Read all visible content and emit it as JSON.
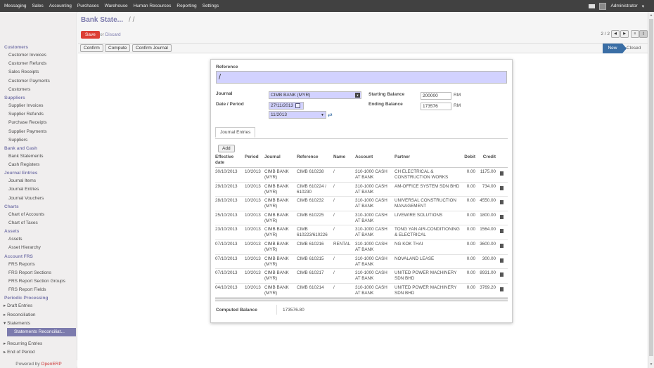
{
  "topbar": {
    "menu": [
      "Messaging",
      "Sales",
      "Accounting",
      "Purchases",
      "Warehouse",
      "Human Resources",
      "Reporting",
      "Settings"
    ],
    "user": "Administrator"
  },
  "sidebar": {
    "sections": [
      {
        "title": "Customers",
        "items": [
          "Customer Invoices",
          "Customer Refunds",
          "Sales Receipts",
          "Customer Payments",
          "Customers"
        ]
      },
      {
        "title": "Suppliers",
        "items": [
          "Supplier Invoices",
          "Supplier Refunds",
          "Purchase Receipts",
          "Supplier Payments",
          "Suppliers"
        ]
      },
      {
        "title": "Bank and Cash",
        "items": [
          "Bank Statements",
          "Cash Registers"
        ]
      },
      {
        "title": "Journal Entries",
        "items": [
          "Journal Items",
          "Journal Entries",
          "Journal Vouchers"
        ]
      },
      {
        "title": "Charts",
        "items": [
          "Chart of Accounts",
          "Chart of Taxes"
        ]
      },
      {
        "title": "Assets",
        "items": [
          "Assets",
          "Asset Hierarchy"
        ]
      },
      {
        "title": "Account FRS",
        "items": [
          "FRS Reports",
          "FRS Report Sections",
          "FRS Report Section Groups",
          "FRS Report Fields"
        ]
      }
    ],
    "periodic": {
      "title": "Periodic Processing",
      "items": [
        "Draft Entries",
        "Reconciliation",
        "Statements"
      ],
      "selected": "Statements Reconciliat...",
      "after": [
        "Recurring Entries",
        "End of Period"
      ]
    },
    "powered_prefix": "Powered by ",
    "powered_brand": "OpenERP"
  },
  "header": {
    "breadcrumb": "Bank State...",
    "breadcrumb_sep": "/ /",
    "save": "Save",
    "or": "or",
    "discard": "Discard",
    "pager": "2 / 2"
  },
  "statusbar": {
    "buttons": [
      "Confirm",
      "Compute",
      "Confirm Journal"
    ],
    "states": [
      "New",
      "Closed"
    ]
  },
  "form": {
    "reference_label": "Reference",
    "reference_value": "/",
    "journal_label": "Journal",
    "journal_value": "CIMB BANK (MYR)",
    "date_label": "Date / Period",
    "date_value": "27/11/2013",
    "period_value": "11/2013",
    "starting_label": "Starting Balance",
    "starting_value": "200000",
    "ending_label": "Ending Balance",
    "ending_value": "173576",
    "currency": "RM",
    "tab": "Journal Entries",
    "add": "Add",
    "computed_label": "Computed Balance",
    "computed_value": "173576.80"
  },
  "grid": {
    "headers": [
      "Effective date",
      "Period",
      "Journal",
      "Reference",
      "Name",
      "Account",
      "Partner",
      "Debit",
      "Credit"
    ],
    "rows": [
      [
        "30/10/2013",
        "10/2013",
        "CIMB BANK (MYR)",
        "CIMB 610238",
        "/",
        "310-1000 CASH AT BANK",
        "CH ELECTRICAL & CONSTRUCTION WORKS",
        "0.00",
        "1175.00"
      ],
      [
        "29/10/2013",
        "10/2013",
        "CIMB BANK (MYR)",
        "CIMB 610224 / 610230",
        "/",
        "310-1000 CASH AT BANK",
        "AM-OFFICE SYSTEM SDN BHD",
        "0.00",
        "734.00"
      ],
      [
        "28/10/2013",
        "10/2013",
        "CIMB BANK (MYR)",
        "CIMB 610232",
        "/",
        "310-1000 CASH AT BANK",
        "UNIVERSAL CONSTRUCTION MANAGEMENT",
        "0.00",
        "4550.00"
      ],
      [
        "25/10/2013",
        "10/2013",
        "CIMB BANK (MYR)",
        "CIMB 610225",
        "/",
        "310-1000 CASH AT BANK",
        "LIVEWIRE SOLUTIONS",
        "0.00",
        "1800.00"
      ],
      [
        "23/10/2013",
        "10/2013",
        "CIMB BANK (MYR)",
        "CIMB 610223/610226",
        "/",
        "310-1000 CASH AT BANK",
        "TONG YAN AIR-CONDITIONING & ELECTRICAL",
        "0.00",
        "1564.00"
      ],
      [
        "07/10/2013",
        "10/2013",
        "CIMB BANK (MYR)",
        "CIMB 610216",
        "RENTAL",
        "310-1000 CASH AT BANK",
        "NG KOK THAI",
        "0.00",
        "3600.00"
      ],
      [
        "07/10/2013",
        "10/2013",
        "CIMB BANK (MYR)",
        "CIMB 610215",
        "/",
        "310-1000 CASH AT BANK",
        "NOVALAND LEASE",
        "0.00",
        "300.00"
      ],
      [
        "07/10/2013",
        "10/2013",
        "CIMB BANK (MYR)",
        "CIMB 610217",
        "/",
        "310-1000 CASH AT BANK",
        "UNITED POWER MACHINERY SDN BHD",
        "0.00",
        "8931.00"
      ],
      [
        "04/10/2013",
        "10/2013",
        "CIMB BANK (MYR)",
        "CIMB 610214",
        "/",
        "310-1000 CASH AT BANK",
        "UNITED POWER MACHINERY SDN BHD",
        "0.00",
        "3769.20"
      ]
    ]
  }
}
